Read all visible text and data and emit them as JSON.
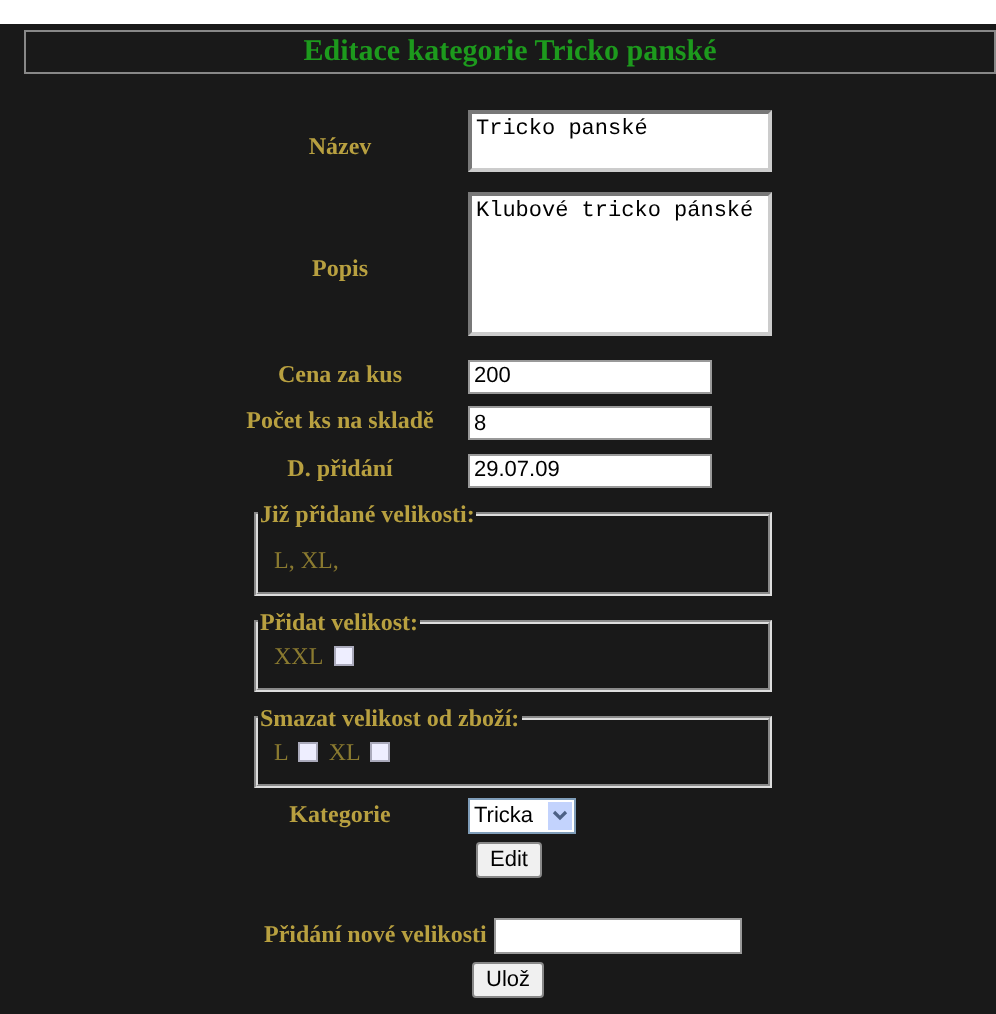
{
  "header": {
    "title": "Editace kategorie Tricko panské"
  },
  "fields": [
    {
      "label": "Název",
      "kind": "textbox",
      "value": "Tricko panské"
    },
    {
      "label": "Popis",
      "kind": "textarea",
      "value": "Klubové tricko pánské"
    },
    {
      "label": "Cena za kus",
      "kind": "text",
      "value": "200"
    },
    {
      "label": "Počet ks na skladě",
      "kind": "text",
      "value": "8"
    },
    {
      "label": "D. přidání",
      "kind": "text",
      "value": "29.07.09"
    }
  ],
  "fieldsets": [
    {
      "legend": "Již přidané velikosti:",
      "kind": "text",
      "text": "L, XL,"
    },
    {
      "legend": "Přidat velikost:",
      "kind": "checkboxes",
      "items": [
        {
          "label": "XXL",
          "checked": false
        }
      ]
    },
    {
      "legend": "Smazat velikost od zboží:",
      "kind": "checkboxes",
      "items": [
        {
          "label": "L",
          "checked": false
        },
        {
          "label": "XL",
          "checked": false
        }
      ]
    }
  ],
  "category": {
    "label": "Kategorie",
    "value": "Tricka"
  },
  "edit_button": "Edit",
  "new_size": {
    "label": "Přidání nové velikosti"
  },
  "save_button": "Ulož"
}
